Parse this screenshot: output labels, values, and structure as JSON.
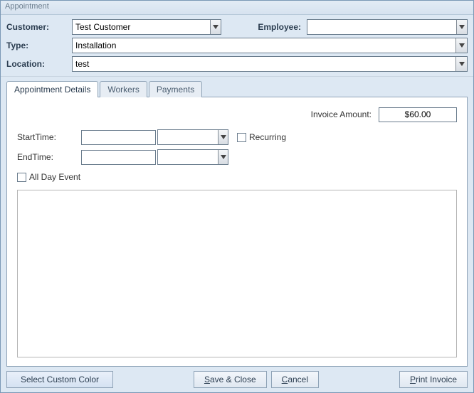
{
  "window": {
    "title": "Appointment"
  },
  "header": {
    "customer_label": "Customer:",
    "customer_value": "Test Customer",
    "employee_label": "Employee:",
    "employee_value": "",
    "type_label": "Type:",
    "type_value": "Installation",
    "location_label": "Location:",
    "location_value": "test"
  },
  "tabs": {
    "details": "Appointment Details",
    "workers": "Workers",
    "payments": "Payments"
  },
  "details": {
    "invoice_label": "Invoice Amount:",
    "invoice_value": "$60.00",
    "start_label": "StartTime:",
    "start_date": "",
    "start_time": "",
    "end_label": "EndTime:",
    "end_date": "",
    "end_time": "",
    "recurring_label": "Recurring",
    "allday_label": "All Day Event"
  },
  "footer": {
    "select_color": "Select Custom Color",
    "save_close_pre": "S",
    "save_close_post": "ave & Close",
    "cancel_pre": "C",
    "cancel_post": "ancel",
    "print_pre": "P",
    "print_post": "rint Invoice"
  }
}
